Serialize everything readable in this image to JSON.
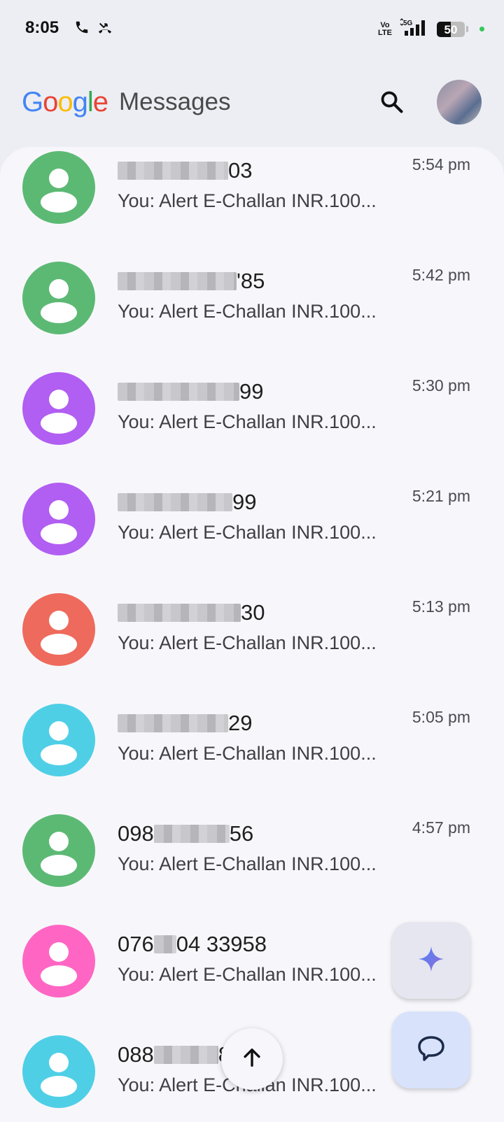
{
  "status_bar": {
    "time": "8:05",
    "volte_label": "Vo\nLTE",
    "network": "5G",
    "battery_level": "50"
  },
  "app_bar": {
    "logo": "Google",
    "title": "Messages"
  },
  "conversations": [
    {
      "name_suffix": "03",
      "time": "5:54 pm",
      "preview": "You: Alert E-Challan INR.100...",
      "avatar_color": "#5cb974"
    },
    {
      "name_suffix": "'85",
      "time": "5:42 pm",
      "preview": "You: Alert E-Challan INR.100...",
      "avatar_color": "#5cb974"
    },
    {
      "name_suffix": "99",
      "time": "5:30 pm",
      "preview": "You: Alert E-Challan INR.100...",
      "avatar_color": "#b15ef2"
    },
    {
      "name_suffix": "99",
      "time": "5:21 pm",
      "preview": "You: Alert E-Challan INR.100...",
      "avatar_color": "#b15ef2"
    },
    {
      "name_suffix": "30",
      "time": "5:13 pm",
      "preview": "You: Alert E-Challan INR.100...",
      "avatar_color": "#ee6a5c"
    },
    {
      "name_suffix": "29",
      "time": "5:05 pm",
      "preview": "You: Alert E-Challan INR.100...",
      "avatar_color": "#4fcfe6"
    },
    {
      "name_prefix": "098",
      "name_suffix": "56",
      "time": "4:57 pm",
      "preview": "You: Alert E-Challan INR.100...",
      "avatar_color": "#5cb974"
    },
    {
      "name_prefix": "076",
      "name_suffix": "04 33958",
      "time": "",
      "preview": "You: Alert E-Challan INR.100...",
      "avatar_color": "#ff66c4"
    },
    {
      "name_prefix": "088",
      "name_suffix": "8",
      "time": "",
      "preview": "You: Alert E-Challan INR.100...",
      "avatar_color": "#4fcfe6"
    }
  ],
  "icons": {
    "search": "search-icon",
    "gemini": "sparkle-icon",
    "start_chat": "chat-bubble-icon",
    "scroll_top": "arrow-up-icon"
  }
}
